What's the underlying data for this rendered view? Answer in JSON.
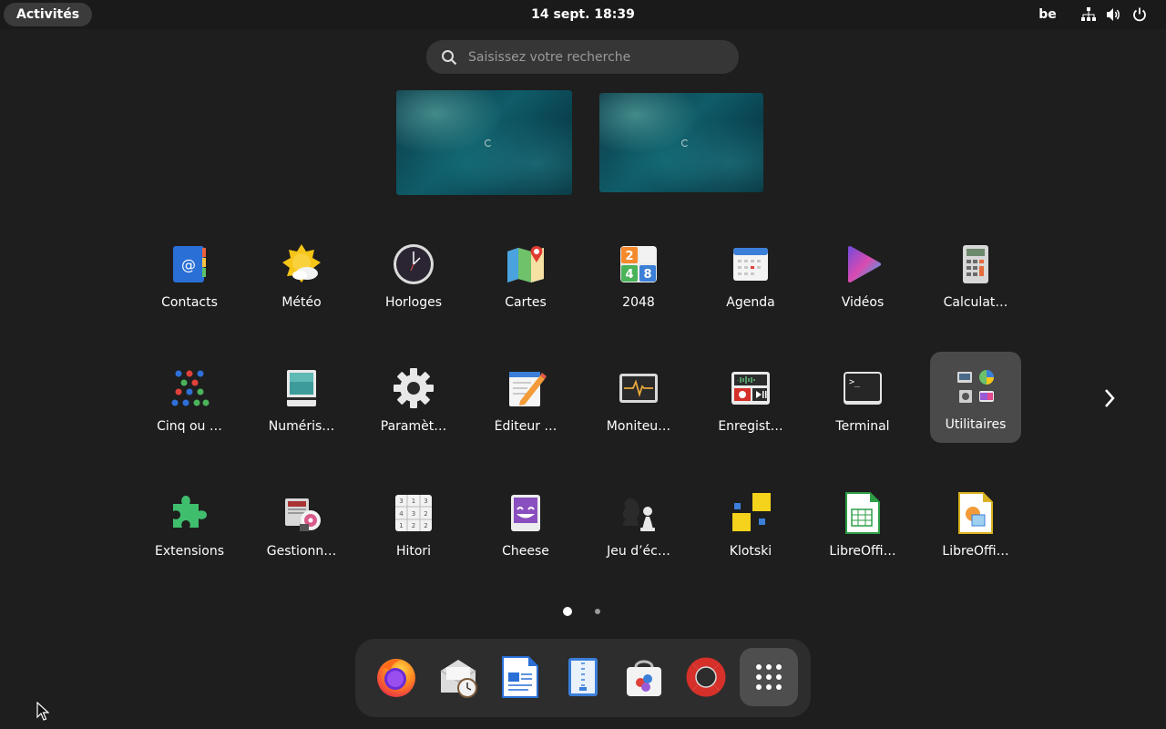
{
  "topbar": {
    "activities_label": "Activités",
    "clock": "14 sept.  18:39",
    "keyboard_layout": "be",
    "tray_icons": [
      "network-icon",
      "volume-icon",
      "power-icon"
    ]
  },
  "search": {
    "placeholder": "Saisissez votre recherche",
    "value": ""
  },
  "workspaces": [
    "workspace-1",
    "workspace-2"
  ],
  "apps": [
    {
      "label": "Contacts"
    },
    {
      "label": "Météo"
    },
    {
      "label": "Horloges"
    },
    {
      "label": "Cartes"
    },
    {
      "label": "2048"
    },
    {
      "label": "Agenda"
    },
    {
      "label": "Vidéos"
    },
    {
      "label": "Calculat…"
    },
    {
      "label": "Cinq ou …"
    },
    {
      "label": "Numéris…"
    },
    {
      "label": "Paramèt…"
    },
    {
      "label": "Éditeur …"
    },
    {
      "label": "Moniteu…"
    },
    {
      "label": "Enregist…"
    },
    {
      "label": "Terminal"
    },
    {
      "label": "Utilitaires"
    },
    {
      "label": "Extensions"
    },
    {
      "label": "Gestionn…"
    },
    {
      "label": "Hitori"
    },
    {
      "label": "Cheese"
    },
    {
      "label": "Jeu d’éc…"
    },
    {
      "label": "Klotski"
    },
    {
      "label": "LibreOffi…"
    },
    {
      "label": "LibreOffi…"
    }
  ],
  "icon_2048": {
    "tiles": [
      "2",
      "",
      "4",
      "8"
    ]
  },
  "pages": {
    "current": 1,
    "total": 2
  },
  "dock": [
    "firefox-icon",
    "evolution-mail-icon",
    "libreoffice-writer-icon",
    "document-viewer-icon",
    "software-store-icon",
    "help-icon",
    "show-apps-icon"
  ],
  "colors": {
    "background": "#1e1e1e",
    "panel": "#1a1a1a",
    "selected": "#4a4a4a",
    "dock": "#2d2d2d"
  }
}
